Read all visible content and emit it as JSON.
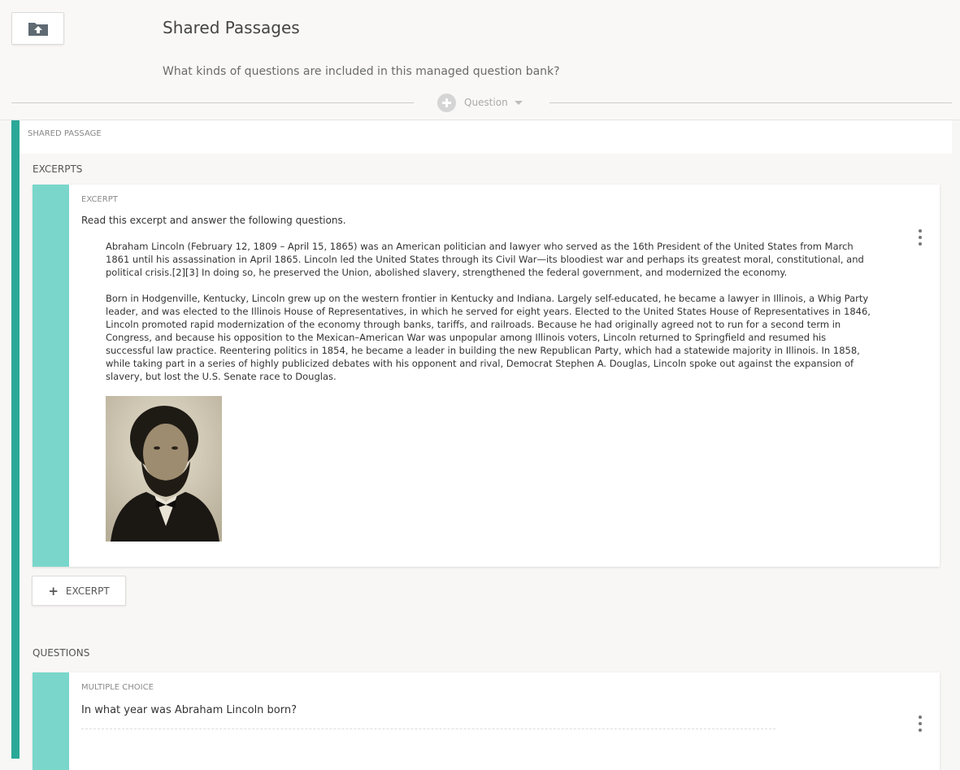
{
  "header": {
    "back_icon": "folder-upload-icon",
    "title": "Shared Passages",
    "description": "What kinds of questions are included in this managed question bank?",
    "add_question_label": "Question",
    "add_question_icon": "plus-circle-icon",
    "add_question_caret": "chevron-down-icon"
  },
  "passage": {
    "type_label": "SHARED PASSAGE",
    "accent_color": "#2aa898",
    "excerpts": {
      "section_label": "EXCERPTS",
      "items": [
        {
          "type_label": "EXCERPT",
          "prompt": "Read this excerpt and answer the following questions.",
          "paragraphs": [
            "Abraham Lincoln (February 12, 1809 – April 15, 1865) was an American politician and lawyer who served as the 16th President of the United States from March 1861 until his assassination in April 1865. Lincoln led the United States through its Civil War—its bloodiest war and perhaps its greatest moral, constitutional, and political crisis.[2][3] In doing so, he preserved the Union, abolished slavery, strengthened the federal government, and modernized the economy.",
            "Born in Hodgenville, Kentucky, Lincoln grew up on the western frontier in Kentucky and Indiana. Largely self-educated, he became a lawyer in Illinois, a Whig Party leader, and was elected to the Illinois House of Representatives, in which he served for eight years. Elected to the United States House of Representatives in 1846, Lincoln promoted rapid modernization of the economy through banks, tariffs, and railroads. Because he had originally agreed not to run for a second term in Congress, and because his opposition to the Mexican–American War was unpopular among Illinois voters, Lincoln returned to Springfield and resumed his successful law practice. Reentering politics in 1854, he became a leader in building the new Republican Party, which had a statewide majority in Illinois. In 1858, while taking part in a series of highly publicized debates with his opponent and rival, Democrat Stephen A. Douglas, Lincoln spoke out against the expansion of slavery, but lost the U.S. Senate race to Douglas."
          ],
          "image_icon": "portrait-photo"
        }
      ],
      "add_label": "EXCERPT"
    },
    "questions": {
      "section_label": "QUESTIONS",
      "items": [
        {
          "type_label": "MULTIPLE CHOICE",
          "text": "In what year was Abraham Lincoln born?"
        }
      ]
    }
  }
}
